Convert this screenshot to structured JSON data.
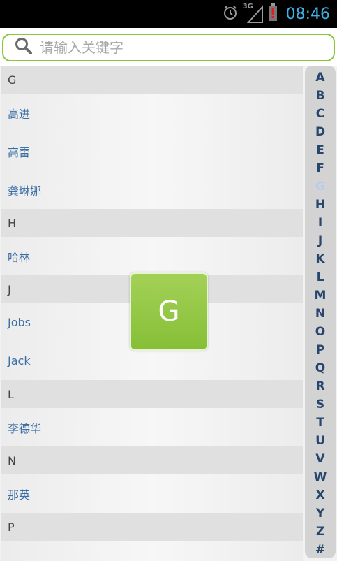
{
  "status_bar": {
    "icons": [
      "alarm-icon",
      "signal-3g-icon",
      "battery-low-icon"
    ],
    "network_label": "3G",
    "time": "08:46",
    "accent_color": "#3fb3e8"
  },
  "search": {
    "placeholder": "请输入关键字",
    "value": "",
    "border_color": "#8cc63f"
  },
  "contacts": [
    {
      "type": "header",
      "text": "G"
    },
    {
      "type": "item",
      "text": "高进"
    },
    {
      "type": "item",
      "text": "高雷"
    },
    {
      "type": "item",
      "text": "龚琳娜"
    },
    {
      "type": "header",
      "text": "H"
    },
    {
      "type": "item",
      "text": "哈林"
    },
    {
      "type": "header",
      "text": "J"
    },
    {
      "type": "item",
      "text": "Jobs"
    },
    {
      "type": "item",
      "text": "Jack"
    },
    {
      "type": "header",
      "text": "L"
    },
    {
      "type": "item",
      "text": "李德华"
    },
    {
      "type": "header",
      "text": "N"
    },
    {
      "type": "item",
      "text": "那英"
    },
    {
      "type": "header",
      "text": "P"
    }
  ],
  "alphabet_index": {
    "letters": [
      "A",
      "B",
      "C",
      "D",
      "E",
      "F",
      "G",
      "H",
      "I",
      "J",
      "K",
      "L",
      "M",
      "N",
      "O",
      "P",
      "Q",
      "R",
      "S",
      "T",
      "U",
      "V",
      "W",
      "X",
      "Y",
      "Z",
      "#"
    ],
    "selected": "G"
  },
  "overlay": {
    "letter": "G",
    "color": "#8cc63f"
  }
}
